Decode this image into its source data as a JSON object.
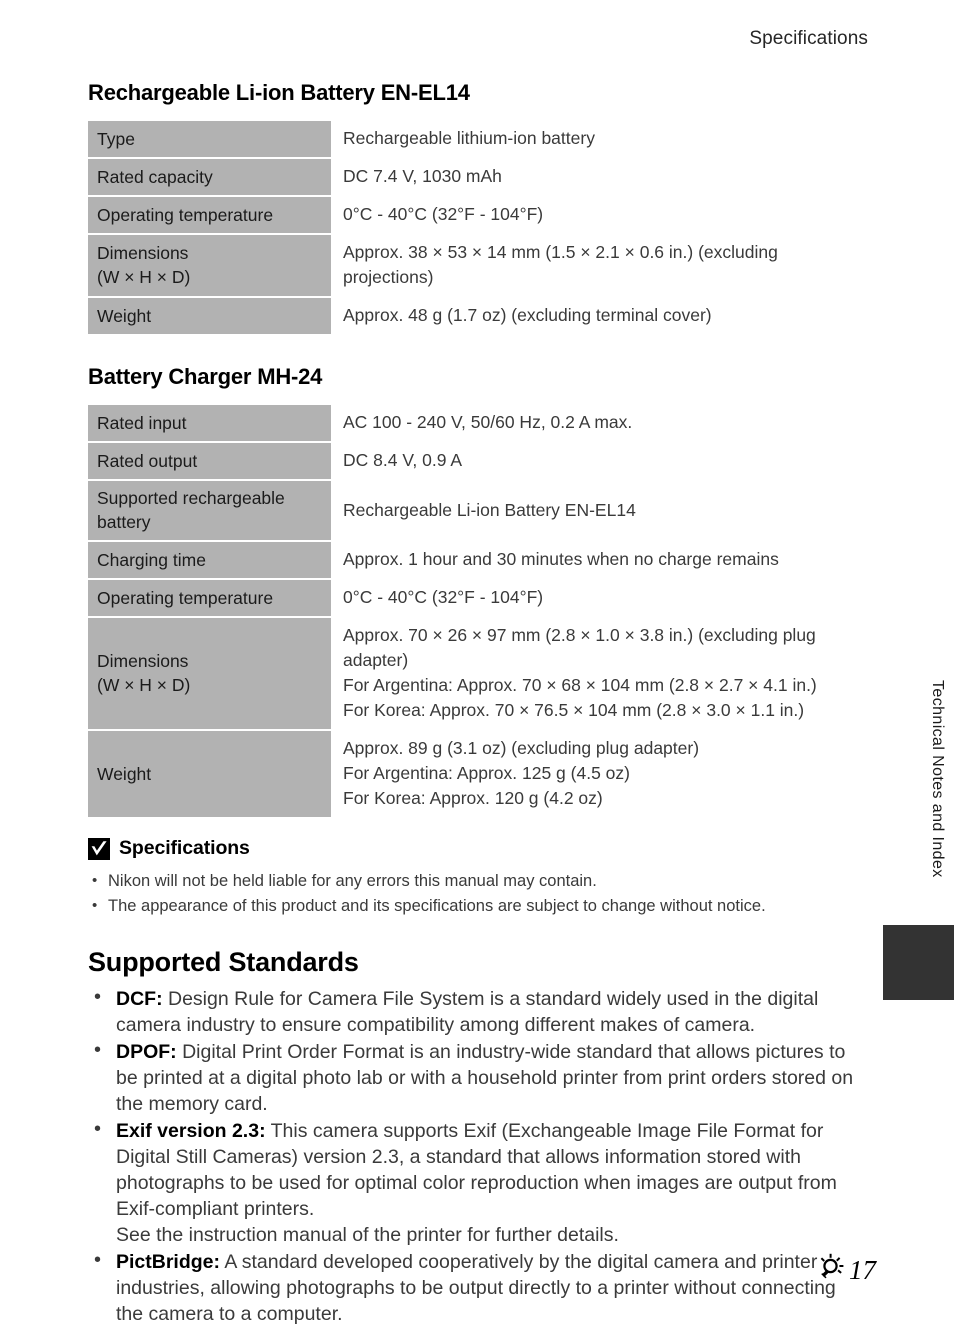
{
  "running_head": "Specifications",
  "battery_section": {
    "heading": "Rechargeable Li-ion Battery EN-EL14",
    "rows": [
      {
        "key": "Type",
        "value": "Rechargeable lithium-ion battery"
      },
      {
        "key": "Rated capacity",
        "value": "DC 7.4 V, 1030 mAh"
      },
      {
        "key": "Operating temperature",
        "value": "0°C - 40°C  (32°F - 104°F)"
      },
      {
        "key_line1": "Dimensions",
        "key_line2": "(W × H × D)",
        "value": "Approx. 38 × 53 × 14 mm (1.5 × 2.1 × 0.6 in.) (excluding projections)"
      },
      {
        "key": "Weight",
        "value": "Approx. 48 g (1.7 oz) (excluding terminal cover)"
      }
    ]
  },
  "charger_section": {
    "heading": "Battery Charger MH-24",
    "rows": [
      {
        "key": "Rated input",
        "value": "AC 100 - 240 V, 50/60 Hz, 0.2 A max."
      },
      {
        "key": "Rated output",
        "value": "DC 8.4 V, 0.9 A"
      },
      {
        "key_line1": "Supported rechargeable",
        "key_line2": "battery",
        "value": "Rechargeable Li-ion Battery EN-EL14"
      },
      {
        "key": "Charging time",
        "value": "Approx. 1 hour and 30 minutes when no charge remains"
      },
      {
        "key": "Operating temperature",
        "value": "0°C - 40°C  (32°F - 104°F)"
      },
      {
        "key_line1": "Dimensions",
        "key_line2": "(W × H × D)",
        "value_lines": [
          "Approx. 70 × 26 × 97 mm (2.8 × 1.0 × 3.8 in.) (excluding plug",
          "adapter)",
          "For Argentina: Approx. 70 × 68 × 104 mm (2.8 × 2.7 × 4.1 in.)",
          "For Korea: Approx. 70 × 76.5 × 104 mm (2.8 × 3.0 × 1.1 in.)"
        ]
      },
      {
        "key": "Weight",
        "value_lines": [
          "Approx. 89 g (3.1 oz) (excluding plug adapter)",
          "For Argentina: Approx. 125 g (4.5 oz)",
          "For Korea: Approx. 120 g (4.2 oz)"
        ]
      }
    ]
  },
  "note": {
    "icon": "check-mark-icon",
    "title": "Specifications",
    "items": [
      "Nikon will not be held liable for any errors this manual may contain.",
      "The appearance of this product and its specifications are subject to change without notice."
    ]
  },
  "standards": {
    "heading": "Supported Standards",
    "items": [
      {
        "term": "DCF:",
        "text": " Design Rule for Camera File System is a standard widely used in the digital camera industry to ensure compatibility among different makes of camera."
      },
      {
        "term": "DPOF:",
        "text": " Digital Print Order Format is an industry-wide standard that allows pictures to be printed at a digital photo lab or with a household printer from print orders stored on the memory card."
      },
      {
        "term": "Exif version 2.3:",
        "text": " This camera supports Exif (Exchangeable Image File Format for Digital Still Cameras) version 2.3, a standard that allows information stored with photographs to be used for optimal color reproduction when images are output from Exif-compliant printers.",
        "extra_line": "See the instruction manual of the printer for further details."
      },
      {
        "term": "PictBridge:",
        "text": " A standard developed cooperatively by the digital camera and printer industries, allowing photographs to be output directly to a printer without connecting the camera to a computer."
      }
    ]
  },
  "side_tab": {
    "label": "Technical Notes and Index"
  },
  "footer": {
    "icon": "lightbulb-icon",
    "page_number": "17"
  },
  "colors": {
    "table_key_bg": "#b2b2b2",
    "side_tab_block": "#333333",
    "body_text": "#3a3a3a",
    "heading_text": "#000000"
  }
}
